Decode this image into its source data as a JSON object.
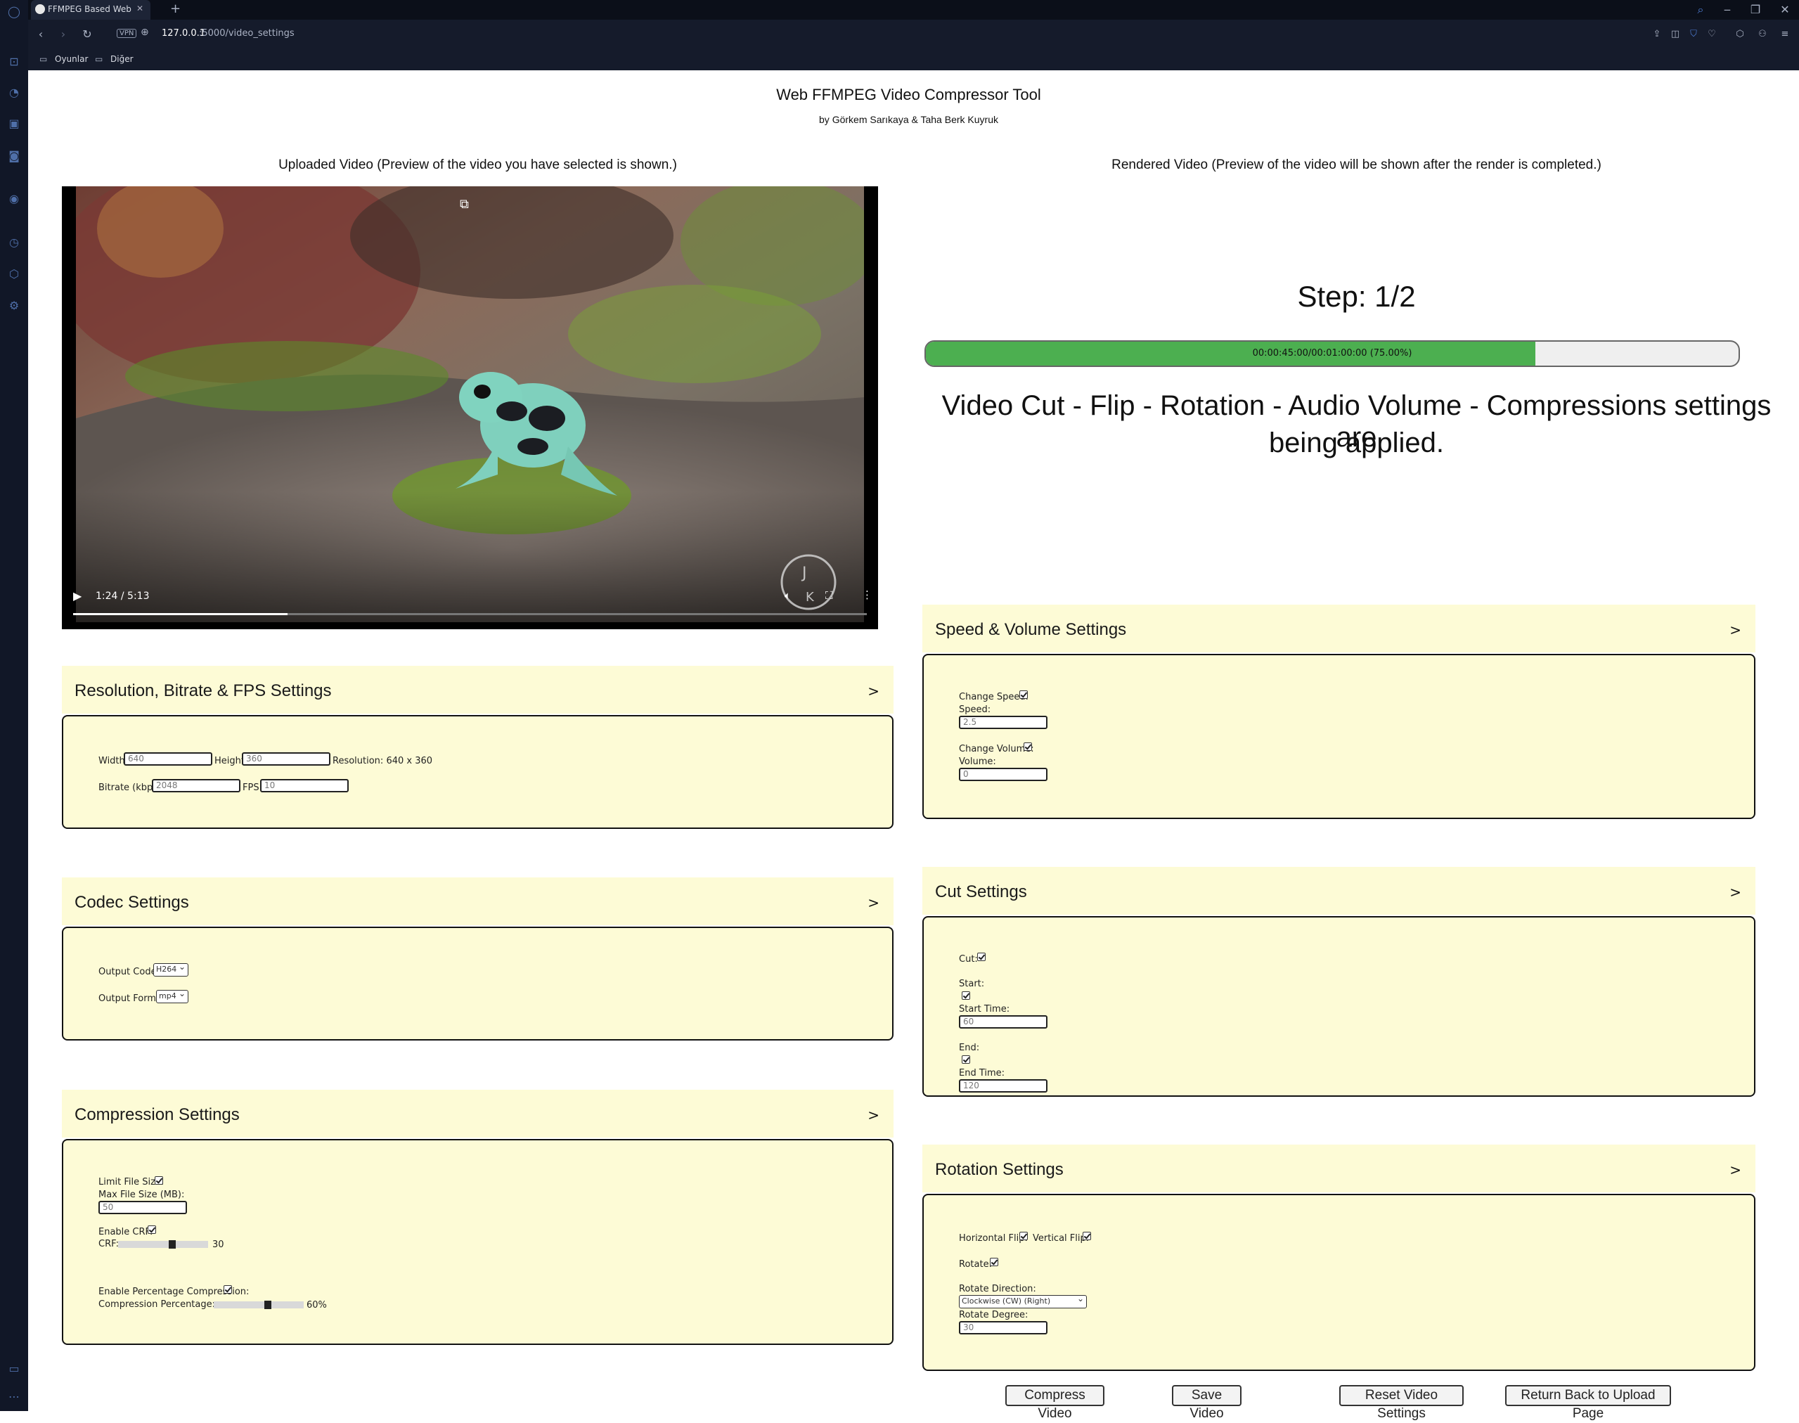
{
  "browser": {
    "tab_title": "FFMPEG Based Web Video",
    "url_host": "127.0.0.1",
    "url_path": ":5000/video_settings",
    "vpn_label": "VPN",
    "bookmarks": [
      "Oyunlar",
      "Diğer"
    ]
  },
  "header": {
    "title": "Web FFMPEG Video Compressor Tool",
    "authors": "by Görkem Sarıkaya & Taha Berk Kuyruk"
  },
  "uploaded": {
    "caption": "Uploaded Video (Preview of the video you have selected is shown.)",
    "time": "1:24 / 5:13",
    "progress": 0.27
  },
  "rendered": {
    "caption": "Rendered Video (Preview of the video will be shown after the render is completed.)",
    "step": "Step: 1/2",
    "progress_text": "00:00:45:00/00:01:00:00 (75.00%)",
    "progress": 0.75,
    "status_line1": "Video Cut - Flip - Rotation - Audio Volume - Compressions settings are",
    "status_line2": "being applied."
  },
  "colors": {
    "panel_bg": "#fdfbd6",
    "progress_fill": "#4caf50"
  },
  "resolution_panel": {
    "title": "Resolution, Bitrate & FPS Settings",
    "arrow": ">",
    "width_label": "Width:",
    "width_value": "640",
    "height_label": "Height:",
    "height_value": "360",
    "resolution_text": "Resolution: 640 x 360",
    "bitrate_label": "Bitrate (kbps):",
    "bitrate_value": "2048",
    "fps_label": "FPS:",
    "fps_value": "10"
  },
  "codec_panel": {
    "title": "Codec Settings",
    "arrow": ">",
    "codec_label": "Output Codec:",
    "codec_value": "H264",
    "format_label": "Output Format:",
    "format_value": "mp4"
  },
  "compression_panel": {
    "title": "Compression Settings",
    "arrow": ">",
    "limit_label": "Limit File Size:",
    "max_label": "Max File Size (MB):",
    "max_value": "50",
    "crf_enable_label": "Enable CRF:",
    "crf_label": "CRF:",
    "crf_value": "30",
    "crf_level": 0.6,
    "pct_enable_label": "Enable Percentage Compression:",
    "pct_label": "Compression Percentage:",
    "pct_value": "60%",
    "pct_level": 0.6
  },
  "speed_panel": {
    "title": "Speed & Volume Settings",
    "arrow": ">",
    "change_speed_label": "Change Speed:",
    "speed_label": "Speed:",
    "speed_value": "2.5",
    "change_volume_label": "Change Volume:",
    "volume_label": "Volume:",
    "volume_value": "0"
  },
  "cut_panel": {
    "title": "Cut Settings",
    "arrow": ">",
    "cut_label": "Cut:",
    "start_label": "Start:",
    "start_time_label": "Start Time:",
    "start_time_value": "60",
    "end_label": "End:",
    "end_time_label": "End Time:",
    "end_time_value": "120"
  },
  "rotation_panel": {
    "title": "Rotation Settings",
    "arrow": ">",
    "hflip_label": "Horizontal Flip:",
    "vflip_label": "Vertical Flip:",
    "rotate_label": "Rotate:",
    "direction_label": "Rotate Direction:",
    "direction_value": "Clockwise (CW) (Right)",
    "degree_label": "Rotate Degree:",
    "degree_value": "30"
  },
  "actions": {
    "compress": "Compress Video",
    "save": "Save Video",
    "reset": "Reset Video Settings",
    "back": "Return Back to Upload Page"
  }
}
